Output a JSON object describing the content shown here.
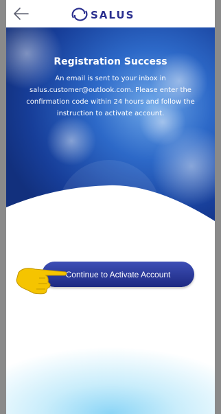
{
  "header": {
    "brand": "SALUS",
    "back_icon": "back-arrow-icon"
  },
  "success": {
    "title": "Registration Success",
    "message": "An email is sent to your inbox in salus.customer@outlook.com. Please enter the confirmation code within 24 hours and follow the instruction to activate account."
  },
  "actions": {
    "continue_label": "Continue to Activate Account"
  },
  "colors": {
    "brand": "#2a2f8f",
    "hero_blue": "#1f54b9",
    "button": "#25339a",
    "pointer_hand": "#f5c400"
  }
}
